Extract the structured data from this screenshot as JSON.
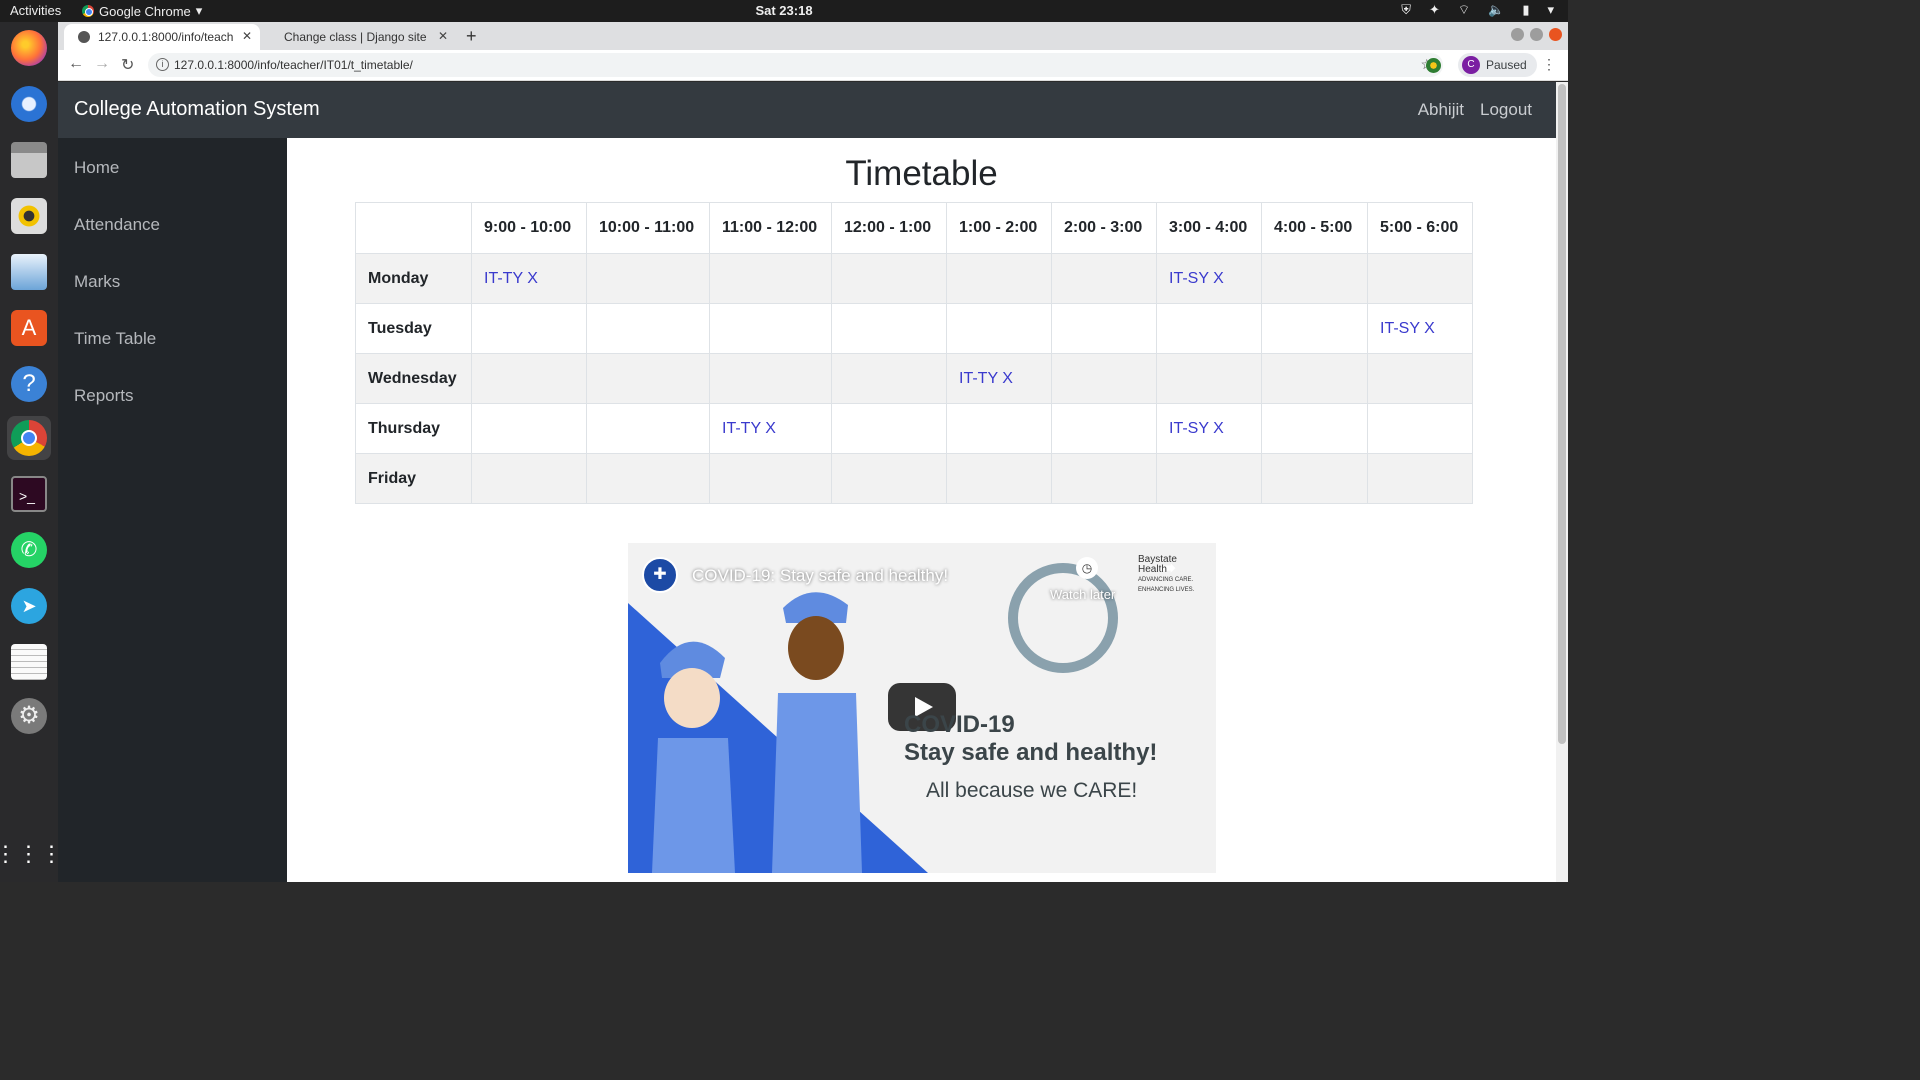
{
  "system": {
    "activities_label": "Activities",
    "app_menu_label": "Google Chrome",
    "clock": "Sat 23:18"
  },
  "browser": {
    "tabs": [
      {
        "label": "127.0.0.1:8000/info/teach"
      },
      {
        "label": "Change class | Django site"
      }
    ],
    "url": "127.0.0.1:8000/info/teacher/IT01/t_timetable/",
    "profile_initial": "C",
    "profile_status": "Paused"
  },
  "navbar": {
    "brand": "College Automation System",
    "user": "Abhijit",
    "logout": "Logout"
  },
  "sidebar": {
    "items": [
      {
        "label": "Home"
      },
      {
        "label": "Attendance"
      },
      {
        "label": "Marks"
      },
      {
        "label": "Time Table"
      },
      {
        "label": "Reports"
      }
    ]
  },
  "timetable": {
    "title": "Timetable",
    "columns": [
      "9:00 - 10:00",
      "10:00 - 11:00",
      "11:00 - 12:00",
      "12:00 - 1:00",
      "1:00 - 2:00",
      "2:00 - 3:00",
      "3:00 - 4:00",
      "4:00 - 5:00",
      "5:00 - 6:00"
    ],
    "rows": [
      {
        "day": "Monday",
        "cells": [
          "IT-TY X",
          "",
          "",
          "",
          "",
          "",
          "IT-SY X",
          "",
          ""
        ]
      },
      {
        "day": "Tuesday",
        "cells": [
          "",
          "",
          "",
          "",
          "",
          "",
          "",
          "",
          "IT-SY X"
        ]
      },
      {
        "day": "Wednesday",
        "cells": [
          "",
          "",
          "",
          "",
          "IT-TY X",
          "",
          "",
          "",
          ""
        ]
      },
      {
        "day": "Thursday",
        "cells": [
          "",
          "",
          "IT-TY X",
          "",
          "",
          "",
          "IT-SY X",
          "",
          ""
        ]
      },
      {
        "day": "Friday",
        "cells": [
          "",
          "",
          "",
          "",
          "",
          "",
          "",
          "",
          ""
        ]
      }
    ]
  },
  "video": {
    "title": "COVID-19: Stay safe and healthy!",
    "watch_later": "Watch later",
    "channel_brand": "Baystate Health",
    "channel_tagline": "ADVANCING CARE. ENHANCING LIVES.",
    "heading_line1": "COVID-19",
    "heading_line2": "Stay safe and healthy!",
    "subheading": "All because we CARE!"
  },
  "colors": {
    "navbar_bg": "#343a40",
    "sidebar_bg": "#212529",
    "link": "#3a3acd"
  }
}
